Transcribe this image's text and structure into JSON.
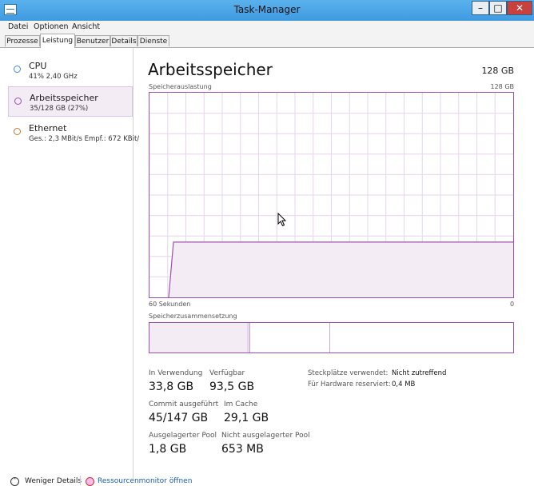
{
  "window": {
    "title": "Task-Manager"
  },
  "menu": [
    "Datei",
    "Optionen",
    "Ansicht"
  ],
  "tabs": [
    "Prozesse",
    "Leistung",
    "Benutzer",
    "Details",
    "Dienste"
  ],
  "active_tab": "Leistung",
  "resources": [
    {
      "name": "CPU",
      "detail": "41% 2,40 GHz",
      "color": "#3a8fd6"
    },
    {
      "name": "Arbeitsspeicher",
      "detail": "35/128 GB (27%)",
      "color": "#9e4fb4"
    },
    {
      "name": "Ethernet",
      "detail": "Ges.: 2,3 MBit/s Empf.: 672 KBit/",
      "color": "#c27a34"
    }
  ],
  "main": {
    "title": "Arbeitsspeicher",
    "total": "128 GB",
    "usage_label": "Speicherauslastung",
    "usage_max": "128 GB",
    "axis_left": "60 Sekunden",
    "axis_right": "0",
    "composition_label": "Speicherzusammensetzung",
    "usage_fraction": 0.27,
    "stats": {
      "in_use_label": "In Verwendung",
      "in_use": "33,8 GB",
      "available_label": "Verfügbar",
      "available": "93,5 GB",
      "committed_label": "Commit ausgeführt",
      "committed": "45/147 GB",
      "cached_label": "Im Cache",
      "cached": "29,1 GB",
      "paged_label": "Ausgelagerter Pool",
      "paged": "1,8 GB",
      "nonpaged_label": "Nicht ausgelagerter Pool",
      "nonpaged": "653 MB"
    },
    "slots_label": "Steckplätze verwendet:",
    "slots_value": "Nicht zutreffend",
    "reserved_label": "Für Hardware reserviert:",
    "reserved_value": "0,4 MB"
  },
  "footer": {
    "less_details": "Weniger Details",
    "resource_monitor": "Ressourcenmonitor öffnen"
  },
  "colors": {
    "accent": "#9e4fb4",
    "fill": "#f3ecf5",
    "titlebar": "#4aa5e8",
    "close": "#c8413c"
  }
}
